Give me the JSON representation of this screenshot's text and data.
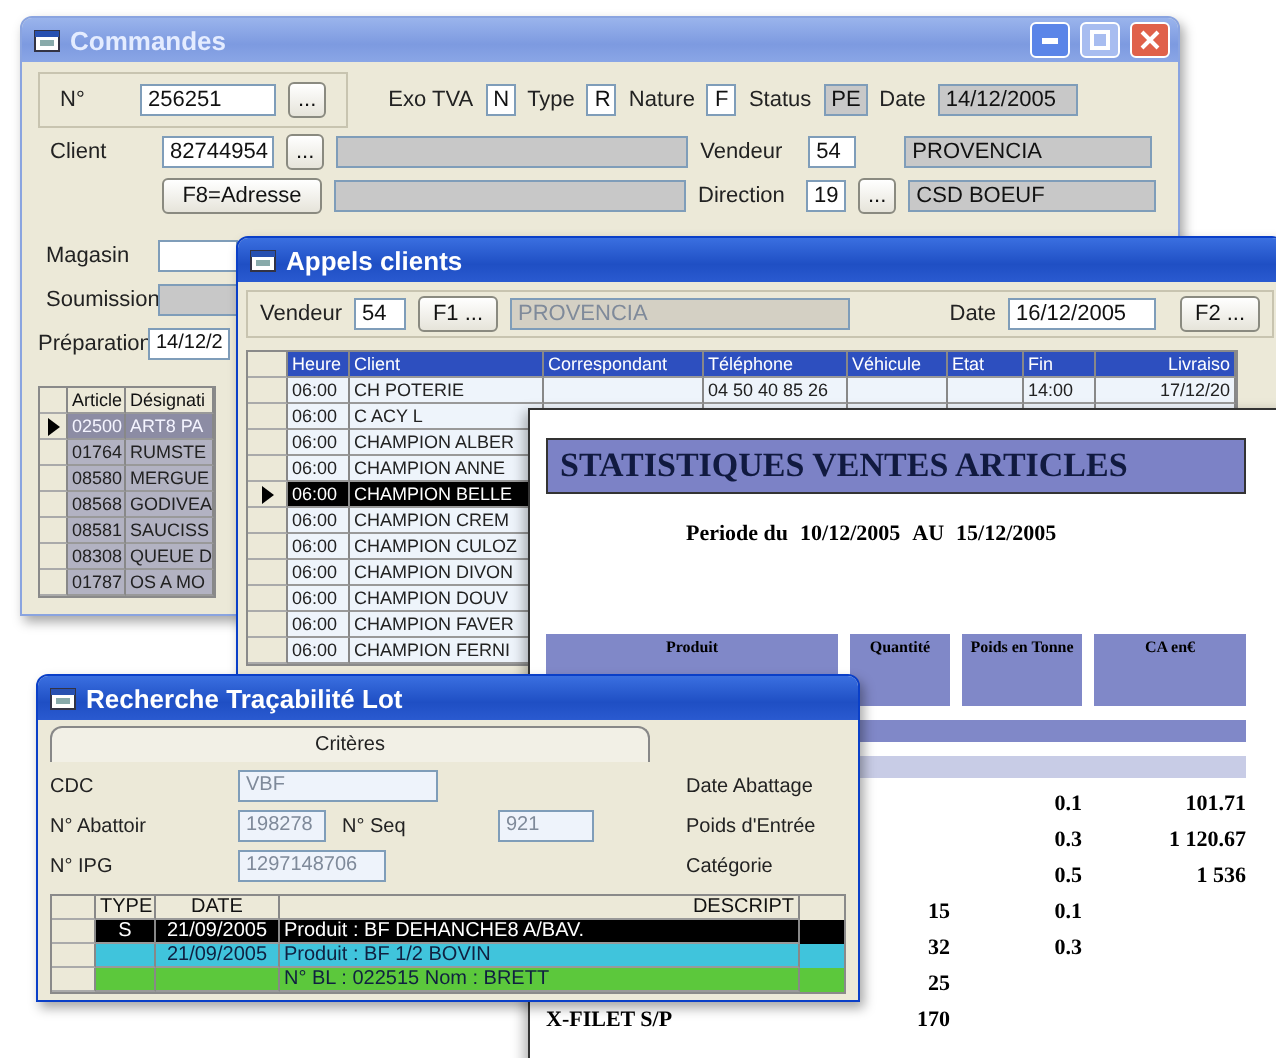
{
  "commandes": {
    "title": "Commandes",
    "number": {
      "label": "N°",
      "value": "256251",
      "button": "..."
    },
    "flags": [
      {
        "label": "Exo TVA",
        "value": "N",
        "readonly": false
      },
      {
        "label": "Type",
        "value": "R",
        "readonly": false
      },
      {
        "label": "Nature",
        "value": "F",
        "readonly": false
      },
      {
        "label": "Status",
        "value": "PE",
        "readonly": true
      },
      {
        "label": "Date",
        "value": "14/12/2005",
        "readonly": true
      }
    ],
    "client": {
      "label": "Client",
      "value": "82744954",
      "button": "..."
    },
    "address_button": "F8=Adresse",
    "vendeur": {
      "label": "Vendeur",
      "code": "54",
      "name": "PROVENCIA"
    },
    "direction": {
      "label": "Direction",
      "code": "19",
      "button": "...",
      "name": "CSD BOEUF"
    },
    "magasin": {
      "label": "Magasin"
    },
    "soumission": {
      "label": "Soumission"
    },
    "preparation": {
      "label": "Préparation",
      "value": "14/12/2"
    },
    "grid": {
      "columns": [
        "Article",
        "Désignati"
      ],
      "rows": [
        {
          "article": "02500",
          "designation": "ART8 PA",
          "selected": true
        },
        {
          "article": "01764",
          "designation": "RUMSTE",
          "selected": false
        },
        {
          "article": "08580",
          "designation": "MERGUE",
          "selected": false
        },
        {
          "article": "08568",
          "designation": "GODIVEA",
          "selected": false
        },
        {
          "article": "08581",
          "designation": "SAUCISS",
          "selected": false
        },
        {
          "article": "08308",
          "designation": "QUEUE D",
          "selected": false
        },
        {
          "article": "01787",
          "designation": "OS A MO",
          "selected": false
        }
      ]
    }
  },
  "appels": {
    "title": "Appels clients",
    "vendeur": {
      "label": "Vendeur",
      "value": "54",
      "button": "F1 ...",
      "name": "PROVENCIA"
    },
    "date": {
      "label": "Date",
      "value": "16/12/2005",
      "button": "F2 ..."
    },
    "grid": {
      "columns": [
        "Heure",
        "Client",
        "Correspondant",
        "Téléphone",
        "Véhicule",
        "Etat",
        "Fin",
        "Livraiso"
      ],
      "rows": [
        {
          "heure": "06:00",
          "client": "CH POTERIE",
          "telephone": "04 50 40 85 26",
          "fin": "14:00",
          "livraison": "17/12/20",
          "selected": false
        },
        {
          "heure": "06:00",
          "client": "C ACY L",
          "selected": false
        },
        {
          "heure": "06:00",
          "client": "CHAMPION ALBER",
          "selected": false
        },
        {
          "heure": "06:00",
          "client": "CHAMPION ANNE",
          "selected": false
        },
        {
          "heure": "06:00",
          "client": "CHAMPION BELLE",
          "selected": true
        },
        {
          "heure": "06:00",
          "client": "CHAMPION CREM",
          "selected": false
        },
        {
          "heure": "06:00",
          "client": "CHAMPION CULOZ",
          "selected": false
        },
        {
          "heure": "06:00",
          "client": "CHAMPION DIVON",
          "selected": false
        },
        {
          "heure": "06:00",
          "client": "CHAMPION DOUV",
          "selected": false
        },
        {
          "heure": "06:00",
          "client": "CHAMPION FAVER",
          "selected": false
        },
        {
          "heure": "06:00",
          "client": "CHAMPION FERNI",
          "selected": false
        }
      ]
    }
  },
  "statistiques": {
    "title": "STATISTIQUES VENTES ARTICLES",
    "period": {
      "label": "Periode du",
      "from": "10/12/2005",
      "separator": "AU",
      "to": "15/12/2005"
    },
    "columns": [
      "Produit",
      "Quantité",
      "Poids en Tonne",
      "CA en€"
    ],
    "rows": [
      {
        "poids": "0.1",
        "ca": "101.71"
      },
      {
        "poids": "0.3",
        "ca": "1 120.67"
      },
      {
        "poids": "0.5",
        "ca": "1 536"
      },
      {
        "quantite": "15",
        "poids": "0.1"
      },
      {
        "quantite": "32",
        "poids": "0.3"
      },
      {
        "quantite": "25"
      },
      {
        "produit": "X-FILET S/P",
        "quantite": "170"
      }
    ]
  },
  "tracabilite": {
    "title": "Recherche Traçabilité Lot",
    "tabs": [
      {
        "label": "Critères",
        "selected": true
      }
    ],
    "field_rows": [
      [
        {
          "label": "CDC",
          "value": "VBF"
        }
      ],
      [
        {
          "label": "N° Abattoir",
          "value": "198278"
        },
        {
          "label": "N° Seq",
          "value": "921"
        }
      ],
      [
        {
          "label": "N° IPG",
          "value": "1297148706"
        }
      ]
    ],
    "side_labels": [
      "Date Abattage",
      "Poids d'Entrée",
      "Catégorie"
    ],
    "grid": {
      "columns": [
        "TYPE",
        "DATE",
        "DESCRIPT"
      ],
      "rows": [
        {
          "type": "S",
          "date": "21/09/2005",
          "description": "Produit : BF DEHANCHE8 A/BAV.",
          "color": "#000000"
        },
        {
          "date": "21/09/2005",
          "description": "Produit : BF 1/2 BOVIN",
          "color": "#40c4dc"
        },
        {
          "description": "N° BL : 022515  Nom : BRETT",
          "color": "#5cc83c"
        }
      ]
    }
  }
}
